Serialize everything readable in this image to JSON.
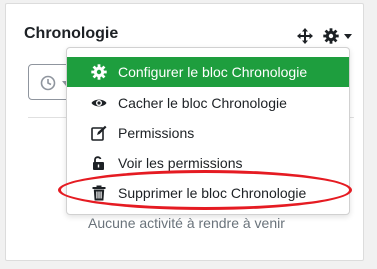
{
  "block": {
    "title": "Chronologie",
    "empty_message": "Aucune activité à rendre à venir"
  },
  "header_icons": [
    "move-icon",
    "gear-icon",
    "caret-down-icon"
  ],
  "menu": {
    "items": [
      {
        "label": "Configurer le bloc Chronologie",
        "icon": "gear-icon",
        "active": true
      },
      {
        "label": "Cacher le bloc Chronologie",
        "icon": "eye-icon",
        "active": false
      },
      {
        "label": "Permissions",
        "icon": "edit-icon",
        "active": false
      },
      {
        "label": "Voir les permissions",
        "icon": "unlock-icon",
        "active": false
      },
      {
        "label": "Supprimer le bloc Chronologie",
        "icon": "trash-icon",
        "active": false
      }
    ]
  },
  "colors": {
    "active_item": "#1e9e3e",
    "highlight": "#e51b22",
    "text": "#1d2125"
  }
}
